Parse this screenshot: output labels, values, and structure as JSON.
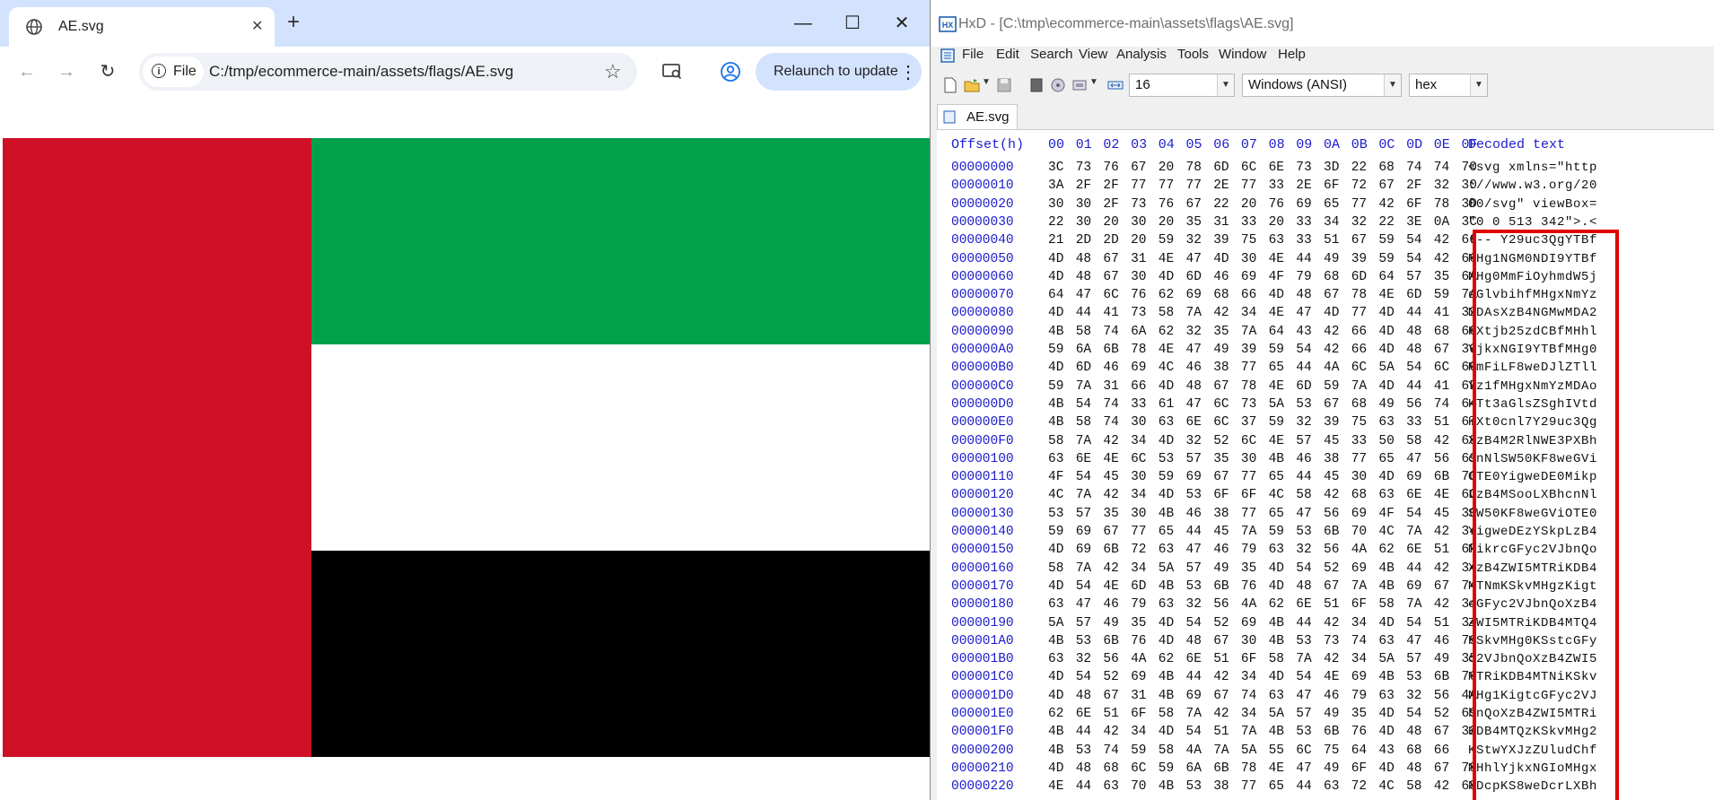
{
  "browser": {
    "tab_title": "AE.svg",
    "tab_close": "✕",
    "new_tab": "+",
    "window_controls": {
      "minimize": "—",
      "maximize": "☐",
      "close": "✕"
    },
    "nav": {
      "back": "←",
      "forward": "→",
      "reload": "↻"
    },
    "address": {
      "chip_icon": "i",
      "chip_label": "File",
      "url": "C:/tmp/ecommerce-main/assets/flags/AE.svg"
    },
    "star": "☆",
    "relaunch_label": "Relaunch to update",
    "menu_dots": "⋮",
    "flag_colors": {
      "red": "#ce1126",
      "green": "#00a14b",
      "white": "#ffffff",
      "black": "#000000"
    }
  },
  "hxd": {
    "title": "HxD - [C:\\tmp\\ecommerce-main\\assets\\flags\\AE.svg]",
    "menu": [
      "File",
      "Edit",
      "Search",
      "View",
      "Analysis",
      "Tools",
      "Window",
      "Help"
    ],
    "toolbar": {
      "bytes_per_row": "16",
      "encoding": "Windows (ANSI)",
      "display": "hex"
    },
    "tab_label": "AE.svg",
    "header": {
      "offset": "Offset(h)",
      "columns": [
        "00",
        "01",
        "02",
        "03",
        "04",
        "05",
        "06",
        "07",
        "08",
        "09",
        "0A",
        "0B",
        "0C",
        "0D",
        "0E",
        "0F"
      ],
      "decoded": "Decoded text"
    },
    "rows": [
      {
        "offset": "00000000",
        "bytes": [
          "3C",
          "73",
          "76",
          "67",
          "20",
          "78",
          "6D",
          "6C",
          "6E",
          "73",
          "3D",
          "22",
          "68",
          "74",
          "74",
          "70"
        ],
        "text": "<svg xmlns=\"http"
      },
      {
        "offset": "00000010",
        "bytes": [
          "3A",
          "2F",
          "2F",
          "77",
          "77",
          "77",
          "2E",
          "77",
          "33",
          "2E",
          "6F",
          "72",
          "67",
          "2F",
          "32",
          "30"
        ],
        "text": "://www.w3.org/20"
      },
      {
        "offset": "00000020",
        "bytes": [
          "30",
          "30",
          "2F",
          "73",
          "76",
          "67",
          "22",
          "20",
          "76",
          "69",
          "65",
          "77",
          "42",
          "6F",
          "78",
          "3D"
        ],
        "text": "00/svg\" viewBox="
      },
      {
        "offset": "00000030",
        "bytes": [
          "22",
          "30",
          "20",
          "30",
          "20",
          "35",
          "31",
          "33",
          "20",
          "33",
          "34",
          "32",
          "22",
          "3E",
          "0A",
          "3C"
        ],
        "text": "\"0 0 513 342\">.<"
      },
      {
        "offset": "00000040",
        "bytes": [
          "21",
          "2D",
          "2D",
          "20",
          "59",
          "32",
          "39",
          "75",
          "63",
          "33",
          "51",
          "67",
          "59",
          "54",
          "42",
          "66"
        ],
        "text": "!-- Y29uc3QgYTBf"
      },
      {
        "offset": "00000050",
        "bytes": [
          "4D",
          "48",
          "67",
          "31",
          "4E",
          "47",
          "4D",
          "30",
          "4E",
          "44",
          "49",
          "39",
          "59",
          "54",
          "42",
          "66"
        ],
        "text": "MHg1NGM0NDI9YTBf"
      },
      {
        "offset": "00000060",
        "bytes": [
          "4D",
          "48",
          "67",
          "30",
          "4D",
          "6D",
          "46",
          "69",
          "4F",
          "79",
          "68",
          "6D",
          "64",
          "57",
          "35",
          "6A"
        ],
        "text": "MHg0MmFiOyhmdW5j"
      },
      {
        "offset": "00000070",
        "bytes": [
          "64",
          "47",
          "6C",
          "76",
          "62",
          "69",
          "68",
          "66",
          "4D",
          "48",
          "67",
          "78",
          "4E",
          "6D",
          "59",
          "7A"
        ],
        "text": "dGlvbihfMHgxNmYz"
      },
      {
        "offset": "00000080",
        "bytes": [
          "4D",
          "44",
          "41",
          "73",
          "58",
          "7A",
          "42",
          "34",
          "4E",
          "47",
          "4D",
          "77",
          "4D",
          "44",
          "41",
          "32"
        ],
        "text": "MDAsXzB4NGMwMDA2"
      },
      {
        "offset": "00000090",
        "bytes": [
          "4B",
          "58",
          "74",
          "6A",
          "62",
          "32",
          "35",
          "7A",
          "64",
          "43",
          "42",
          "66",
          "4D",
          "48",
          "68",
          "6C"
        ],
        "text": "KXtjb25zdCBfMHhl"
      },
      {
        "offset": "000000A0",
        "bytes": [
          "59",
          "6A",
          "6B",
          "78",
          "4E",
          "47",
          "49",
          "39",
          "59",
          "54",
          "42",
          "66",
          "4D",
          "48",
          "67",
          "30"
        ],
        "text": "YjkxNGI9YTBfMHg0"
      },
      {
        "offset": "000000B0",
        "bytes": [
          "4D",
          "6D",
          "46",
          "69",
          "4C",
          "46",
          "38",
          "77",
          "65",
          "44",
          "4A",
          "6C",
          "5A",
          "54",
          "6C",
          "6C"
        ],
        "text": "MmFiLF8weDJlZTll"
      },
      {
        "offset": "000000C0",
        "bytes": [
          "59",
          "7A",
          "31",
          "66",
          "4D",
          "48",
          "67",
          "78",
          "4E",
          "6D",
          "59",
          "7A",
          "4D",
          "44",
          "41",
          "6F"
        ],
        "text": "Yz1fMHgxNmYzMDAo"
      },
      {
        "offset": "000000D0",
        "bytes": [
          "4B",
          "54",
          "74",
          "33",
          "61",
          "47",
          "6C",
          "73",
          "5A",
          "53",
          "67",
          "68",
          "49",
          "56",
          "74",
          "64"
        ],
        "text": "KTt3aGlsZSghIVtd"
      },
      {
        "offset": "000000E0",
        "bytes": [
          "4B",
          "58",
          "74",
          "30",
          "63",
          "6E",
          "6C",
          "37",
          "59",
          "32",
          "39",
          "75",
          "63",
          "33",
          "51",
          "67"
        ],
        "text": "KXt0cnl7Y29uc3Qg"
      },
      {
        "offset": "000000F0",
        "bytes": [
          "58",
          "7A",
          "42",
          "34",
          "4D",
          "32",
          "52",
          "6C",
          "4E",
          "57",
          "45",
          "33",
          "50",
          "58",
          "42",
          "68"
        ],
        "text": "XzB4M2RlNWE3PXBh"
      },
      {
        "offset": "00000100",
        "bytes": [
          "63",
          "6E",
          "4E",
          "6C",
          "53",
          "57",
          "35",
          "30",
          "4B",
          "46",
          "38",
          "77",
          "65",
          "47",
          "56",
          "69"
        ],
        "text": "cnNlSW50KF8weGVi"
      },
      {
        "offset": "00000110",
        "bytes": [
          "4F",
          "54",
          "45",
          "30",
          "59",
          "69",
          "67",
          "77",
          "65",
          "44",
          "45",
          "30",
          "4D",
          "69",
          "6B",
          "70"
        ],
        "text": "OTE0YigweDE0Mikp"
      },
      {
        "offset": "00000120",
        "bytes": [
          "4C",
          "7A",
          "42",
          "34",
          "4D",
          "53",
          "6F",
          "6F",
          "4C",
          "58",
          "42",
          "68",
          "63",
          "6E",
          "4E",
          "6C"
        ],
        "text": "LzB4MSooLXBhcnNl"
      },
      {
        "offset": "00000130",
        "bytes": [
          "53",
          "57",
          "35",
          "30",
          "4B",
          "46",
          "38",
          "77",
          "65",
          "47",
          "56",
          "69",
          "4F",
          "54",
          "45",
          "30"
        ],
        "text": "SW50KF8weGViOTE0"
      },
      {
        "offset": "00000140",
        "bytes": [
          "59",
          "69",
          "67",
          "77",
          "65",
          "44",
          "45",
          "7A",
          "59",
          "53",
          "6B",
          "70",
          "4C",
          "7A",
          "42",
          "34"
        ],
        "text": "YigweDEzYSkpLzB4"
      },
      {
        "offset": "00000150",
        "bytes": [
          "4D",
          "69",
          "6B",
          "72",
          "63",
          "47",
          "46",
          "79",
          "63",
          "32",
          "56",
          "4A",
          "62",
          "6E",
          "51",
          "6F"
        ],
        "text": "MikrcGFyc2VJbnQo"
      },
      {
        "offset": "00000160",
        "bytes": [
          "58",
          "7A",
          "42",
          "34",
          "5A",
          "57",
          "49",
          "35",
          "4D",
          "54",
          "52",
          "69",
          "4B",
          "44",
          "42",
          "34"
        ],
        "text": "XzB4ZWI5MTRiKDB4"
      },
      {
        "offset": "00000170",
        "bytes": [
          "4D",
          "54",
          "4E",
          "6D",
          "4B",
          "53",
          "6B",
          "76",
          "4D",
          "48",
          "67",
          "7A",
          "4B",
          "69",
          "67",
          "74"
        ],
        "text": "MTNmKSkvMHgzKigt"
      },
      {
        "offset": "00000180",
        "bytes": [
          "63",
          "47",
          "46",
          "79",
          "63",
          "32",
          "56",
          "4A",
          "62",
          "6E",
          "51",
          "6F",
          "58",
          "7A",
          "42",
          "34"
        ],
        "text": "cGFyc2VJbnQoXzB4"
      },
      {
        "offset": "00000190",
        "bytes": [
          "5A",
          "57",
          "49",
          "35",
          "4D",
          "54",
          "52",
          "69",
          "4B",
          "44",
          "42",
          "34",
          "4D",
          "54",
          "51",
          "34"
        ],
        "text": "ZWI5MTRiKDB4MTQ4"
      },
      {
        "offset": "000001A0",
        "bytes": [
          "4B",
          "53",
          "6B",
          "76",
          "4D",
          "48",
          "67",
          "30",
          "4B",
          "53",
          "73",
          "74",
          "63",
          "47",
          "46",
          "79"
        ],
        "text": "KSkvMHg0KSstcGFy"
      },
      {
        "offset": "000001B0",
        "bytes": [
          "63",
          "32",
          "56",
          "4A",
          "62",
          "6E",
          "51",
          "6F",
          "58",
          "7A",
          "42",
          "34",
          "5A",
          "57",
          "49",
          "35"
        ],
        "text": "c2VJbnQoXzB4ZWI5"
      },
      {
        "offset": "000001C0",
        "bytes": [
          "4D",
          "54",
          "52",
          "69",
          "4B",
          "44",
          "42",
          "34",
          "4D",
          "54",
          "4E",
          "69",
          "4B",
          "53",
          "6B",
          "76"
        ],
        "text": "MTRiKDB4MTNiKSkv"
      },
      {
        "offset": "000001D0",
        "bytes": [
          "4D",
          "48",
          "67",
          "31",
          "4B",
          "69",
          "67",
          "74",
          "63",
          "47",
          "46",
          "79",
          "63",
          "32",
          "56",
          "4A"
        ],
        "text": "MHg1KigtcGFyc2VJ"
      },
      {
        "offset": "000001E0",
        "bytes": [
          "62",
          "6E",
          "51",
          "6F",
          "58",
          "7A",
          "42",
          "34",
          "5A",
          "57",
          "49",
          "35",
          "4D",
          "54",
          "52",
          "69"
        ],
        "text": "bnQoXzB4ZWI5MTRi"
      },
      {
        "offset": "000001F0",
        "bytes": [
          "4B",
          "44",
          "42",
          "34",
          "4D",
          "54",
          "51",
          "7A",
          "4B",
          "53",
          "6B",
          "76",
          "4D",
          "48",
          "67",
          "32"
        ],
        "text": "KDB4MTQzKSkvMHg2"
      },
      {
        "offset": "00000200",
        "bytes": [
          "4B",
          "53",
          "74",
          "59",
          "58",
          "4A",
          "7A",
          "5A",
          "55",
          "6C",
          "75",
          "64",
          "43",
          "68",
          "66"
        ],
        "text": "KStwYXJzZUludChf"
      },
      {
        "offset": "00000210",
        "bytes": [
          "4D",
          "48",
          "68",
          "6C",
          "59",
          "6A",
          "6B",
          "78",
          "4E",
          "47",
          "49",
          "6F",
          "4D",
          "48",
          "67",
          "78"
        ],
        "text": "MHhlYjkxNGIoMHgx"
      },
      {
        "offset": "00000220",
        "bytes": [
          "4E",
          "44",
          "63",
          "70",
          "4B",
          "53",
          "38",
          "77",
          "65",
          "44",
          "63",
          "72",
          "4C",
          "58",
          "42",
          "68"
        ],
        "text": "NDcpKS8weDcrLXBh"
      }
    ]
  }
}
